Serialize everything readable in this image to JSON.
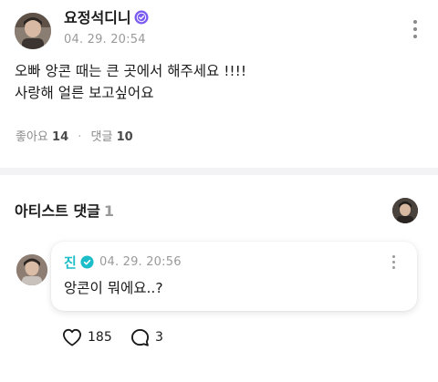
{
  "post": {
    "username": "요정석디니",
    "timestamp": "04. 29. 20:54",
    "body_lines": [
      "오빠 앙콘 때는 큰 곳에서 해주세요 !!!!",
      "사랑해 얼른 보고싶어요"
    ],
    "likes_label": "좋아요",
    "likes_count": "14",
    "comments_label": "댓글",
    "comments_count": "10"
  },
  "artist_section": {
    "title": "아티스트 댓글",
    "count": "1"
  },
  "comment": {
    "author": "진",
    "timestamp": "04. 29. 20:56",
    "text": "앙콘이 뭐에요..?",
    "like_count": "185",
    "reply_count": "3"
  },
  "colors": {
    "artist_accent": "#1bbdc9",
    "verified_badge": "#7b5cf0",
    "divider": "#f3f3f5",
    "muted_text": "#9a9a9a"
  },
  "icons": {
    "post_verified": "verified-badge-icon",
    "comment_verified": "verified-badge-icon",
    "like": "heart-outline-icon",
    "reply": "speech-bubble-icon",
    "more": "more-vertical-icon"
  }
}
